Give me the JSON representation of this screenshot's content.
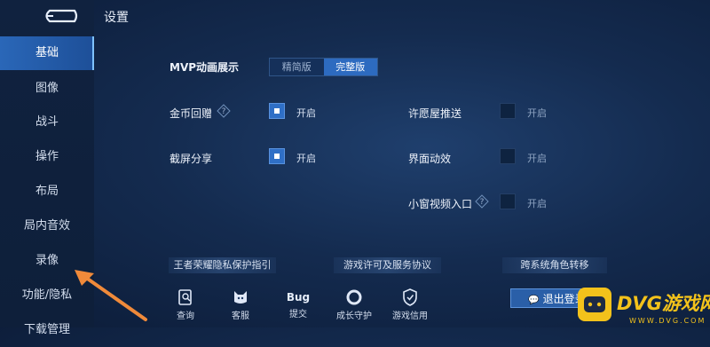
{
  "header": {
    "title": "设置"
  },
  "sidebar": {
    "items": [
      {
        "label": "基础",
        "active": true
      },
      {
        "label": "图像"
      },
      {
        "label": "战斗"
      },
      {
        "label": "操作"
      },
      {
        "label": "布局"
      },
      {
        "label": "局内音效"
      },
      {
        "label": "录像"
      },
      {
        "label": "功能/隐私"
      },
      {
        "label": "下载管理"
      }
    ]
  },
  "settings": {
    "mvp": {
      "label": "MVP动画展示",
      "options": [
        "精简版",
        "完整版"
      ],
      "selected": "完整版"
    },
    "coin_feedback": {
      "label": "金币回赠",
      "state_label": "开启",
      "checked": true
    },
    "screenshot_share": {
      "label": "截屏分享",
      "state_label": "开启",
      "checked": true
    },
    "wish_push": {
      "label": "许愿屋推送",
      "state_label": "开启",
      "checked": false
    },
    "ui_animation": {
      "label": "界面动效",
      "state_label": "开启",
      "checked": false
    },
    "small_window_video": {
      "label": "小窗视频入口",
      "state_label": "开启",
      "checked": false
    }
  },
  "links": {
    "privacy_guide": "王者荣耀隐私保护指引",
    "license": "游戏许可及服务协议",
    "transfer": "跨系统角色转移"
  },
  "bottom_bar": {
    "query": "查询",
    "service": "客服",
    "bug_icon_text": "Bug",
    "bug": "提交",
    "guardian": "成长守护",
    "credit": "游戏信用"
  },
  "logout": {
    "label": "退出登录"
  },
  "watermark": {
    "brand": "DVG游戏网",
    "url": "WWW.DVG.COM"
  },
  "colors": {
    "accent": "#2d6bc0",
    "arrow": "#f08a3a"
  }
}
